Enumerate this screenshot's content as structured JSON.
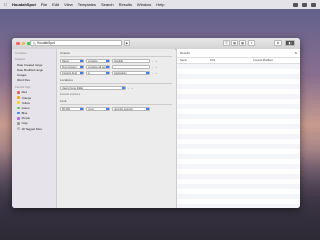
{
  "menubar": {
    "app": "HoudahSpot",
    "items": [
      "File",
      "Edit",
      "View",
      "Templates",
      "Search",
      "Results",
      "Window",
      "Help"
    ]
  },
  "toolbar": {
    "search_value": "HoudahSpot",
    "colors": {
      "close": "#fc605b",
      "min": "#fdbc40",
      "max": "#34c84a"
    }
  },
  "sidebar": {
    "sections": [
      {
        "header": "Templates",
        "items": []
      },
      {
        "header": "Snippets",
        "items": [
          {
            "label": "Date Created range"
          },
          {
            "label": "Date Modified range"
          },
          {
            "label": "Images"
          },
          {
            "label": "Word files"
          }
        ]
      },
      {
        "header": "Favorite Tags",
        "items": [
          {
            "label": "Red",
            "color": "#f05b5b"
          },
          {
            "label": "Orange",
            "color": "#f5a623"
          },
          {
            "label": "Yellow",
            "color": "#f5d623"
          },
          {
            "label": "Green",
            "color": "#5ac85a"
          },
          {
            "label": "Blue",
            "color": "#3b82f6"
          },
          {
            "label": "Purple",
            "color": "#b16fd8"
          },
          {
            "label": "Gray",
            "color": "#999999"
          },
          {
            "label": "All Tagged Files",
            "color": "#bbbbbb"
          }
        ]
      }
    ]
  },
  "criteria": {
    "header": "Criteria",
    "rows": [
      {
        "attribute": "Name",
        "operator": "contains",
        "value": "Houdah"
      },
      {
        "attribute": "Text Content",
        "operator": "contains all words",
        "value": ""
      },
      {
        "attribute": "Content Kind",
        "operator": "is",
        "value": "Application"
      }
    ]
  },
  "locations": {
    "header": "Locations",
    "primary": "Users home folder",
    "secondary": "Exclude locations"
  },
  "limit": {
    "header": "Limit",
    "count": "50 000",
    "unit": "most",
    "order": "recently opened"
  },
  "results": {
    "header": "Results",
    "columns": [
      "Name",
      "Kind",
      "Content Modified"
    ]
  }
}
